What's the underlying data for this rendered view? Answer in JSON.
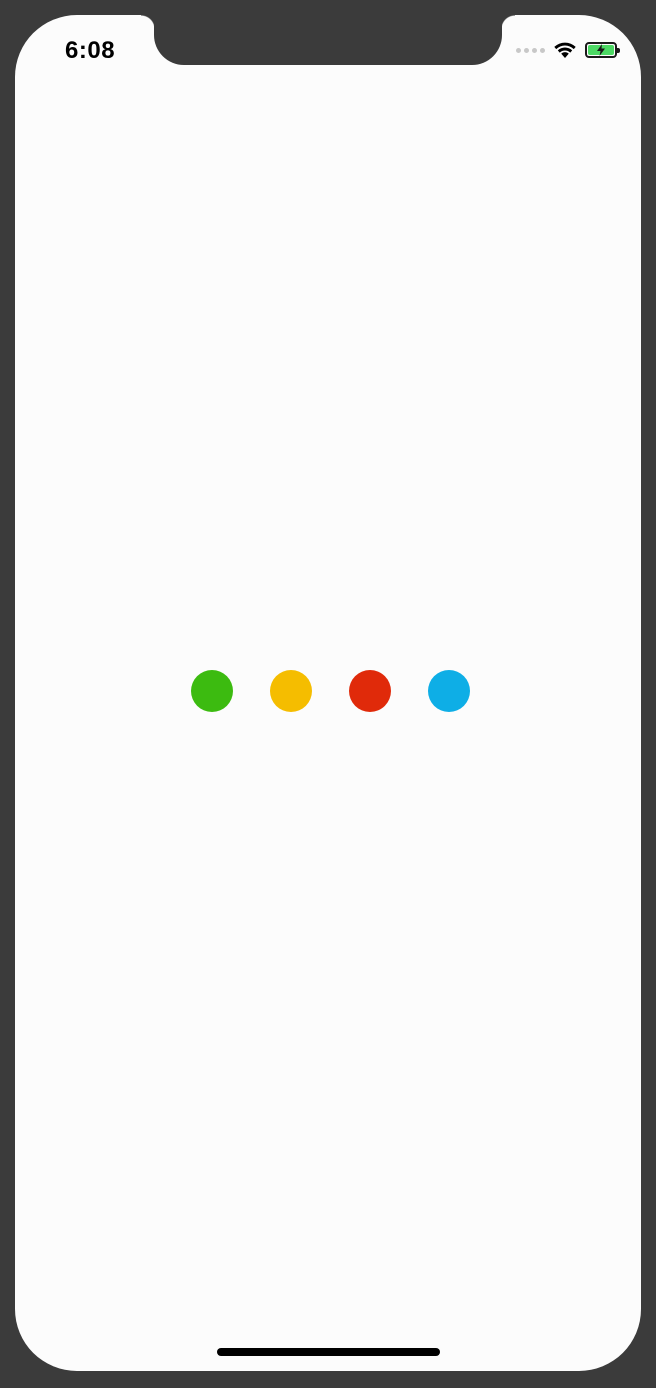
{
  "status_bar": {
    "time": "6:08",
    "signal_icon": "cellular-dots-icon",
    "wifi_icon": "wifi-icon",
    "battery_icon": "battery-charging-icon",
    "battery_level": 1.0
  },
  "loader": {
    "dots": [
      {
        "name": "loading-dot-green",
        "color": "#3cbb10"
      },
      {
        "name": "loading-dot-yellow",
        "color": "#f5bd00"
      },
      {
        "name": "loading-dot-red",
        "color": "#e02a0a"
      },
      {
        "name": "loading-dot-blue",
        "color": "#0eaee6"
      }
    ]
  },
  "colors": {
    "frame": "#3b3b3b",
    "screen_bg": "#fcfcfc",
    "battery_green": "#4cd964"
  }
}
